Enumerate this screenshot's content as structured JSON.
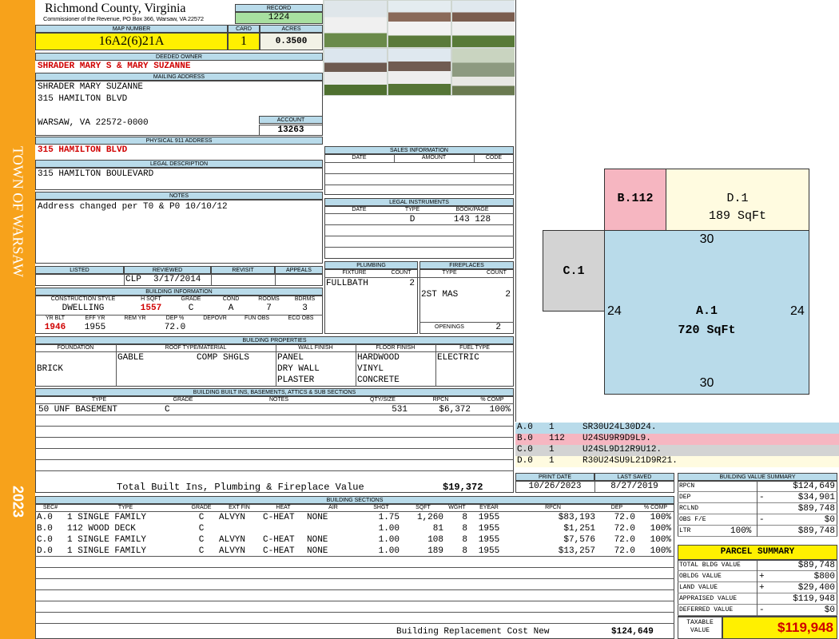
{
  "sidebar": {
    "town": "TOWN OF WARSAW",
    "year": "2023"
  },
  "header": {
    "county": "Richmond County, Virginia",
    "commissioner": "Commissioner of the Revenue, PO Box 366, Warsaw, VA 22572",
    "record_label": "RECORD",
    "record": "1224",
    "map_label": "MAP NUMBER",
    "map_number": "16A2(6)21A",
    "card_label": "CARD",
    "card": "1",
    "acres_label": "ACRES",
    "acres": "0.3500"
  },
  "owner": {
    "deeded_label": "DEEDED OWNER",
    "deeded": "SHRADER MARY S & MARY SUZANNE",
    "mailing_label": "MAILING ADDRESS",
    "mail1": "SHRADER MARY SUZANNE",
    "mail2": "315 HAMILTON BLVD",
    "mail3": "WARSAW, VA 22572-0000",
    "account_label": "ACCOUNT",
    "account": "13263",
    "physical_label": "PHYSICAL 911 ADDRESS",
    "physical": "315 HAMILTON BLVD",
    "legal_label": "LEGAL DESCRIPTION",
    "legal": "315 HAMILTON BOULEVARD",
    "notes_label": "NOTES",
    "notes": "Address changed per T0 & P0 10/10/12"
  },
  "sales": {
    "title": "SALES INFORMATION",
    "cols": [
      "DATE",
      "AMOUNT",
      "CODE"
    ]
  },
  "legal_inst": {
    "title": "LEGAL INSTRUMENTS",
    "cols": [
      "DATE",
      "TYPE",
      "BOOK/PAGE"
    ],
    "type": "D",
    "book": "143 128"
  },
  "review": {
    "listed_label": "LISTED",
    "reviewed_label": "REVIEWED",
    "revisit_label": "REVISIT",
    "appeals_label": "APPEALS",
    "reviewed_by": "CLP",
    "reviewed_date": "3/17/2014"
  },
  "plumbing": {
    "title": "PLUMBING",
    "fixture_label": "FIXTURE",
    "count_label": "COUNT",
    "fixture": "FULLBATH",
    "count": "2"
  },
  "fireplaces": {
    "title": "FIREPLACES",
    "type_label": "TYPE",
    "count_label": "COUNT",
    "type": "2ST MAS",
    "count": "2",
    "openings_label": "OPENINGS",
    "openings": "2"
  },
  "building_info": {
    "title": "BUILDING INFORMATION",
    "cs_label": "CONSTRUCTION STYLE",
    "hsqft_label": "H SQFT",
    "grade_label": "GRADE",
    "cond_label": "COND",
    "rooms_label": "ROOMS",
    "bdrms_label": "BDRMS",
    "style": "DWELLING",
    "hsqft": "1557",
    "grade": "C",
    "cond": "A",
    "rooms": "7",
    "bdrms": "3",
    "yrblt_label": "YR BLT",
    "effyr_label": "EFF YR",
    "remyr_label": "REM YR",
    "dep_label": "DEP %",
    "depovr_label": "DEPOVR",
    "funobs_label": "FUN OBS",
    "ecoobs_label": "ECO OBS",
    "yrblt": "1946",
    "effyr": "1955",
    "dep": "72.0"
  },
  "properties": {
    "title": "BUILDING PROPERTIES",
    "foundation_label": "FOUNDATION",
    "roof_label": "ROOF TYPE/MATERIAL",
    "wall_label": "WALL FINISH",
    "floor_label": "FLOOR FINISH",
    "fuel_label": "FUEL TYPE",
    "foundation": "BRICK",
    "roof_type": "GABLE",
    "roof_mat": "COMP SHGLS",
    "wall1": "PANEL",
    "wall2": "DRY WALL",
    "wall3": "PLASTER",
    "floor1": "HARDWOOD",
    "floor2": "VINYL",
    "floor3": "CONCRETE",
    "fuel": "ELECTRIC"
  },
  "builtins": {
    "title": "BUILDING BUILT INS, BASEMENTS, ATTICS & SUB SECTIONS",
    "cols": [
      "TYPE",
      "GRADE",
      "NOTES",
      "QTY/SIZE",
      "RPCN",
      "% COMP"
    ],
    "row": {
      "type": "50 UNF BASEMENT",
      "grade": "C",
      "qty": "531",
      "rpcn": "$6,372",
      "comp": "100%"
    },
    "total_label": "Total Built Ins, Plumbing & Fireplace Value",
    "total": "$19,372"
  },
  "sketch": {
    "b_label": "B.112",
    "d_label": "D.1",
    "d_area": "189 SqFt",
    "c_label": "C.1",
    "a_label": "A.1",
    "a_area": "720 SqFt",
    "top": "30",
    "bottom": "30",
    "left": "24",
    "right": "24"
  },
  "legend": [
    {
      "sec": "A.0",
      "n": "1",
      "code": "SR30U24L30D24.",
      "color": "#b9dbea"
    },
    {
      "sec": "B.0",
      "n": "112",
      "code": "U24SU9R9D9L9.",
      "color": "#f6b6c1"
    },
    {
      "sec": "C.0",
      "n": "1",
      "code": "U24SL9D12R9U12.",
      "color": "#d3d3d3"
    },
    {
      "sec": "D.0",
      "n": "1",
      "code": "R30U24SU9L21D9R21.",
      "color": "#fffbe0"
    }
  ],
  "dates": {
    "print_label": "PRINT DATE",
    "saved_label": "LAST SAVED",
    "print": "10/26/2023",
    "saved": "8/27/2019"
  },
  "sections": {
    "title": "BUILDING SECTIONS",
    "cols": [
      "SEC#",
      "TYPE",
      "GRADE",
      "EXT FIN",
      "HEAT",
      "AIR",
      "SHGT",
      "SQFT",
      "WGHT",
      "EYEAR",
      "RPCN",
      "DEP",
      "% COMP"
    ],
    "rows": [
      [
        "A.0",
        "1 SINGLE FAMILY",
        "C",
        "ALVYN",
        "C-HEAT",
        "NONE",
        "1.75",
        "1,260",
        "8",
        "1955",
        "$83,193",
        "72.0",
        "100%"
      ],
      [
        "B.0",
        "112 WOOD DECK",
        "C",
        "",
        "",
        "",
        "1.00",
        "81",
        "8",
        "1955",
        "$1,251",
        "72.0",
        "100%"
      ],
      [
        "C.0",
        "1 SINGLE FAMILY",
        "C",
        "ALVYN",
        "C-HEAT",
        "NONE",
        "1.00",
        "108",
        "8",
        "1955",
        "$7,576",
        "72.0",
        "100%"
      ],
      [
        "D.0",
        "1 SINGLE FAMILY",
        "C",
        "ALVYN",
        "C-HEAT",
        "NONE",
        "1.00",
        "189",
        "8",
        "1955",
        "$13,257",
        "72.0",
        "100%"
      ]
    ],
    "total_label": "Building Replacement Cost New",
    "total": "$124,649"
  },
  "bvs": {
    "title": "BUILDING VALUE SUMMARY",
    "rpcn_label": "RPCN",
    "rpcn": "$124,649",
    "dep_label": "DEP",
    "dep_sign": "-",
    "dep": "$34,901",
    "rclnd_label": "RCLND",
    "rclnd": "$89,748",
    "obs_label": "OBS F/E",
    "obs_sign": "-",
    "obs": "$0",
    "ltr_label": "LTR",
    "ltr_pct": "100%",
    "ltr": "$89,748"
  },
  "parcel": {
    "title": "PARCEL SUMMARY",
    "tbv_label": "TOTAL BLDG VALUE",
    "tbv": "$89,748",
    "obv_label": "OBLDG VALUE",
    "obv_sign": "+",
    "obv": "$800",
    "land_label": "LAND VALUE",
    "land_sign": "+",
    "land": "$29,400",
    "app_label": "APPRAISED VALUE",
    "app": "$119,948",
    "def_label": "DEFERRED VALUE",
    "def_sign": "-",
    "def": "$0",
    "tax_label1": "TAXABLE",
    "tax_label2": "VALUE",
    "tax": "$119,948"
  }
}
